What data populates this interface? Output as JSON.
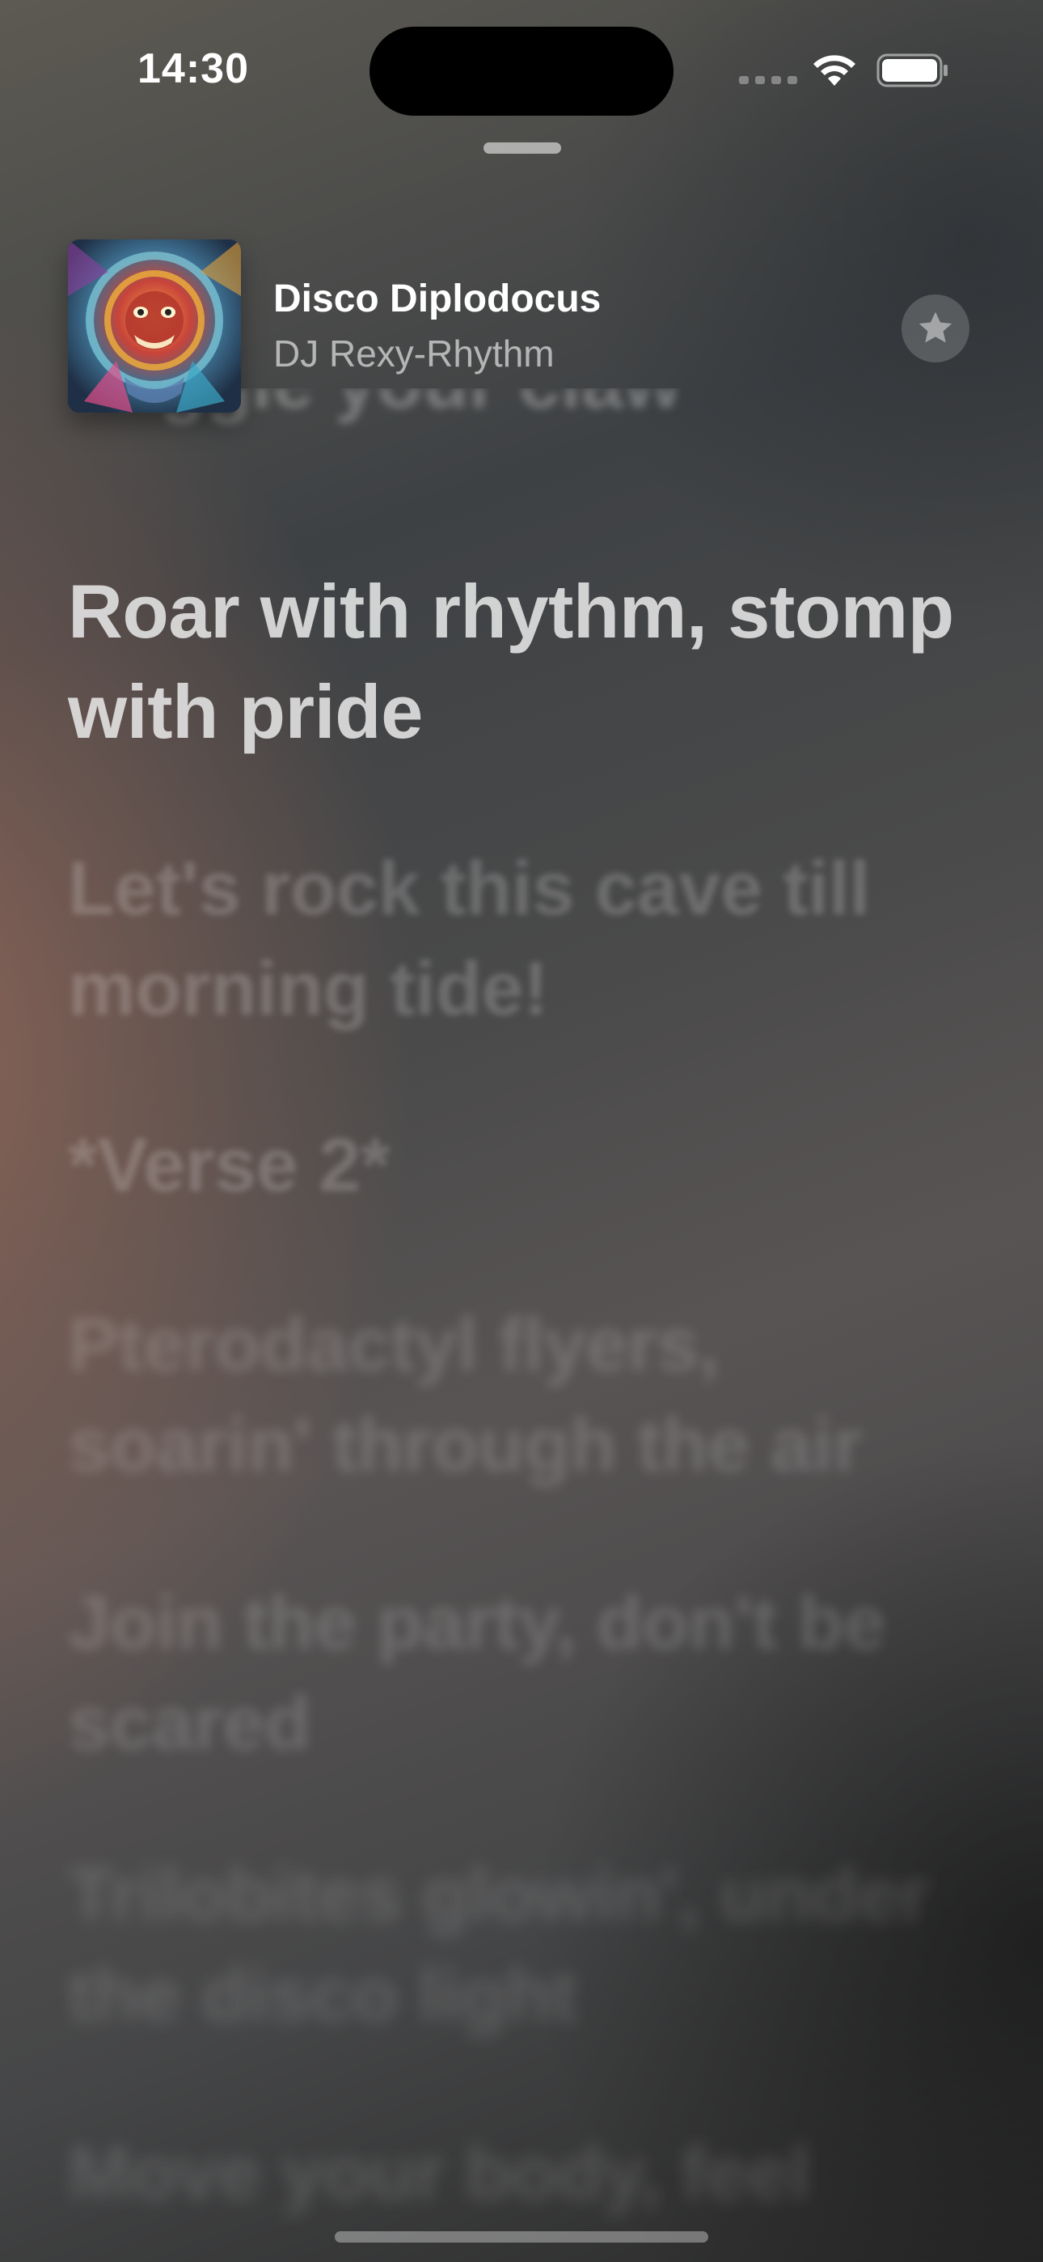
{
  "status_bar": {
    "time": "14:30"
  },
  "now_playing": {
    "title": "Disco Diplodocus",
    "artist": "DJ Rexy-Rhythm"
  },
  "lyrics": {
    "previous": "Wiggle your claw",
    "current": "Roar with rhythm, stomp with pride",
    "upcoming": [
      "Let's rock this cave till morning tide!",
      "*Verse 2*",
      "Pterodactyl flyers, soarin' through the air",
      "Join the party, don't be scared",
      "Trilobites glowin', under the disco light",
      "Move your body, feel"
    ]
  },
  "icons": {
    "wifi": "wifi-icon",
    "battery": "battery-icon",
    "signal": "cellular-signal-icon",
    "favorite": "star-icon"
  }
}
